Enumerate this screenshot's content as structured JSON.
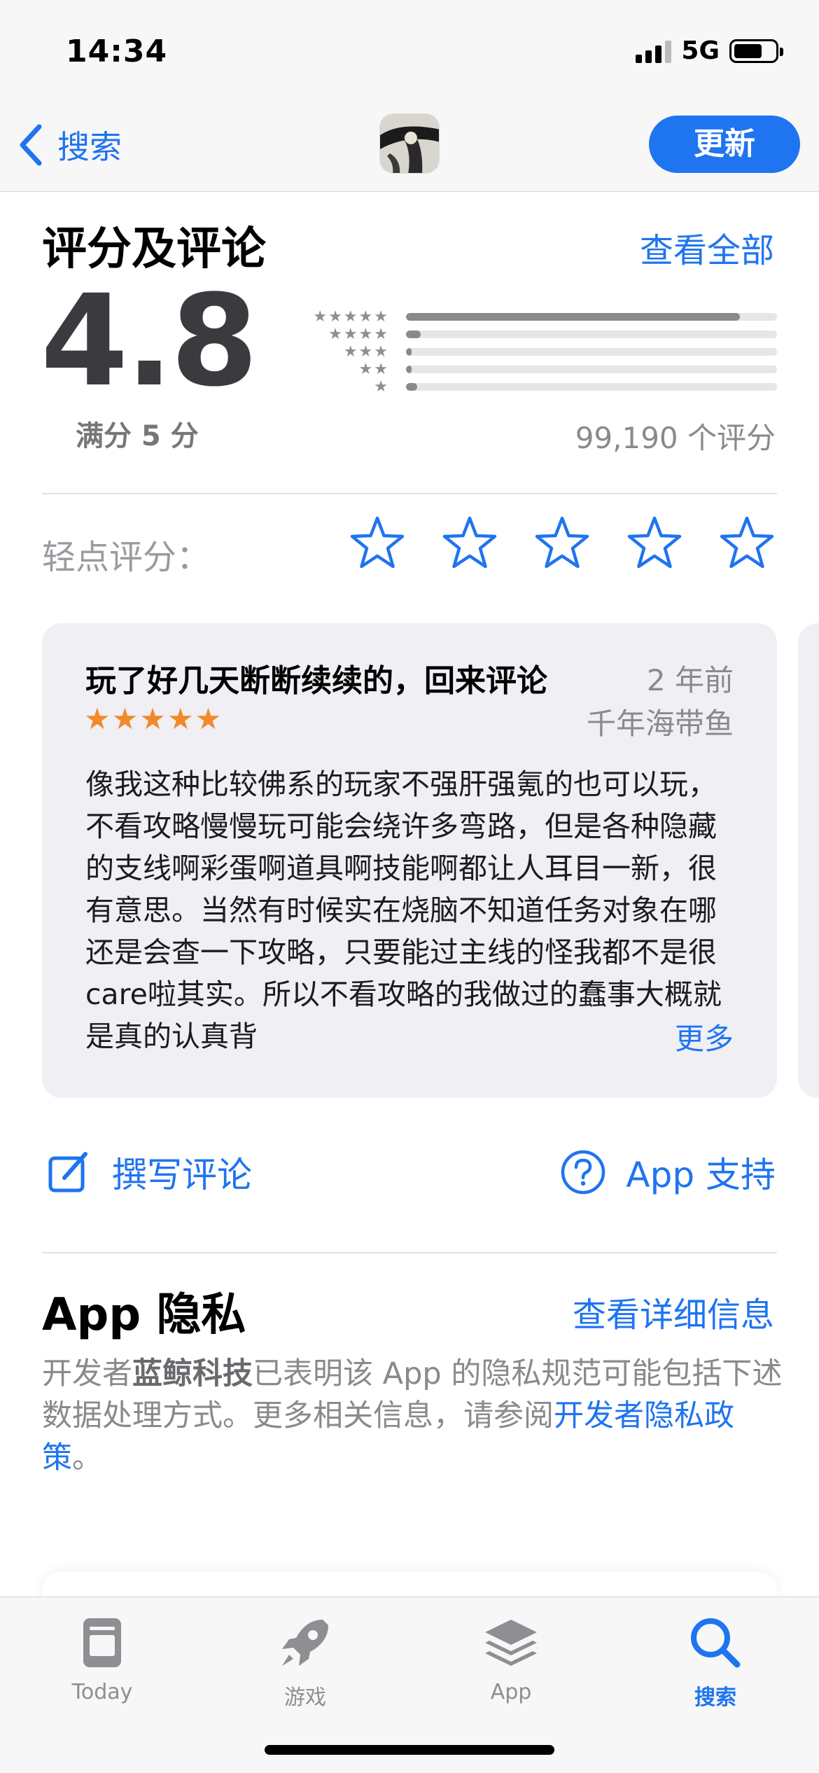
{
  "status": {
    "time": "14:34",
    "network": "5G"
  },
  "nav": {
    "back_label": "搜索",
    "update_label": "更新"
  },
  "ratings": {
    "title": "评分及评论",
    "see_all": "查看全部",
    "score": "4.8",
    "out_of": "满分 5 分",
    "count": "99,190 个评分",
    "histogram": [
      {
        "stars": 5,
        "fraction": 0.9
      },
      {
        "stars": 4,
        "fraction": 0.04
      },
      {
        "stars": 3,
        "fraction": 0.015
      },
      {
        "stars": 2,
        "fraction": 0.01
      },
      {
        "stars": 1,
        "fraction": 0.03
      }
    ]
  },
  "tap_to_rate": {
    "label": "轻点评分："
  },
  "review": {
    "title": "玩了好几天断断续续的，回来评论",
    "date": "2 年前",
    "author": "千年海带鱼",
    "stars": 5,
    "body": "像我这种比较佛系的玩家不强肝强氪的也可以玩，不看攻略慢慢玩可能会绕许多弯路，但是各种隐藏的支线啊彩蛋啊道具啊技能啊都让人耳目一新，很有意思。当然有时候实在烧脑不知道任务对象在哪还是会查一下攻略，只要能过主线的怪我都不是很care啦其实。所以不看攻略的我做过的蠢事大概就是真的认真背",
    "more": "更多"
  },
  "actions": {
    "write_review": "撰写评论",
    "app_support": "App 支持"
  },
  "privacy": {
    "title": "App 隐私",
    "details_link": "查看详细信息",
    "text_prefix": "开发者",
    "developer": "蓝鲸科技",
    "text_middle": "已表明该 App 的隐私规范可能包括下述数据处理方式。更多相关信息，请参阅",
    "policy_link": "开发者隐私政策",
    "text_suffix": "。"
  },
  "tabs": [
    {
      "label": "Today",
      "icon": "today-icon",
      "active": false
    },
    {
      "label": "游戏",
      "icon": "rocket-icon",
      "active": false
    },
    {
      "label": "App",
      "icon": "app-stack-icon",
      "active": false
    },
    {
      "label": "搜索",
      "icon": "search-icon",
      "active": true
    }
  ],
  "colors": {
    "accent": "#1f74f0",
    "star_orange": "#f08a2a",
    "score_gray": "#3b3b3f"
  }
}
